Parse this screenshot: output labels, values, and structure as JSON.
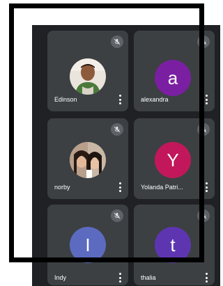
{
  "participants": [
    {
      "name": "Edinson",
      "avatar_type": "photo",
      "muted": true
    },
    {
      "name": "alexandra",
      "avatar_type": "letter",
      "initial": "a",
      "color": "#7b1fa2",
      "muted": true
    },
    {
      "name": "norby",
      "avatar_type": "photo",
      "muted": true
    },
    {
      "name": "Yolanda Patri...",
      "avatar_type": "letter",
      "initial": "Y",
      "color": "#c2185b",
      "muted": true
    },
    {
      "name": "Indy",
      "avatar_type": "letter",
      "initial": "I",
      "color": "#5c6bc0",
      "muted": true
    },
    {
      "name": "thalia",
      "avatar_type": "letter",
      "initial": "t",
      "color": "#5e35b1",
      "muted": true
    }
  ],
  "icons": {
    "mute": "mic-off-icon",
    "more": "more-vert-icon"
  },
  "colors": {
    "background": "#202124",
    "tile": "#3c4043",
    "mute_badge": "#5f6368",
    "frame": "#000000"
  }
}
